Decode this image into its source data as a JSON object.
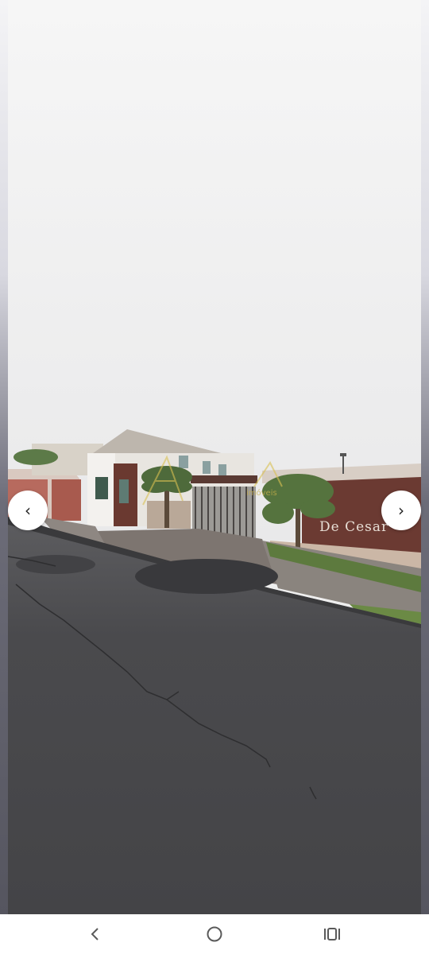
{
  "photo": {
    "description_icon": "photo-viewer",
    "sign_text": "De Cesar",
    "watermark_text": "imóveis"
  },
  "carousel": {
    "prev_icon": "chevron-left-icon",
    "prev_glyph": "‹",
    "next_icon": "chevron-right-icon",
    "next_glyph": "›"
  },
  "system_nav": {
    "back_icon": "back-icon",
    "home_icon": "home-icon",
    "recent_icon": "recent-apps-icon"
  },
  "colors": {
    "sky": "#f1f1f1",
    "road": "#4a4a4c",
    "wall_sign": "#6b3a32",
    "nav_bg": "#ffffff",
    "nav_icon": "#5a5a5a"
  }
}
